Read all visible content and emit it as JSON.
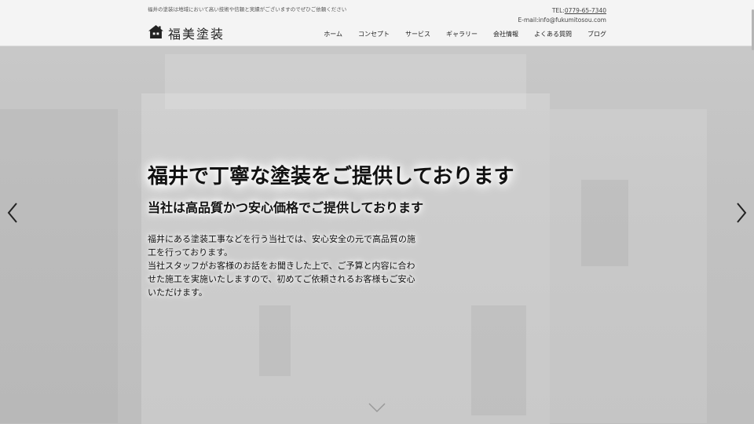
{
  "header": {
    "tagline": "福井の塗装は地域において高い技術や信頼と実績がございますのでぜひご依頼ください",
    "logo_text": "福美塗装",
    "logo_icon": "house-icon",
    "tel_label": "TEL:",
    "tel_number": "0779-65-7340",
    "email": "E-mail:info@fukumitosou.com"
  },
  "nav": {
    "items": [
      {
        "label": "ホーム"
      },
      {
        "label": "コンセプト"
      },
      {
        "label": "サービス"
      },
      {
        "label": "ギャラリー"
      },
      {
        "label": "会社情報"
      },
      {
        "label": "よくある質問"
      },
      {
        "label": "ブログ"
      }
    ]
  },
  "hero": {
    "title": "福井で丁寧な塗装をご提供しております",
    "subtitle": "当社は高品質かつ安心価格でご提供しております",
    "body_lines": [
      "福井にある塗装工事などを行う当社では、安心安全の元で高品質の施",
      "工を行っております。",
      "当社スタッフがお客様のお話をお聞きした上で、ご予算と内容に合わ",
      "せた施工を実施いたしますので、初めてご依頼されるお客様もご安心",
      "いただけます。"
    ],
    "prev_icon": "chevron-left-icon",
    "next_icon": "chevron-right-icon",
    "scroll_icon": "chevron-down-icon"
  }
}
